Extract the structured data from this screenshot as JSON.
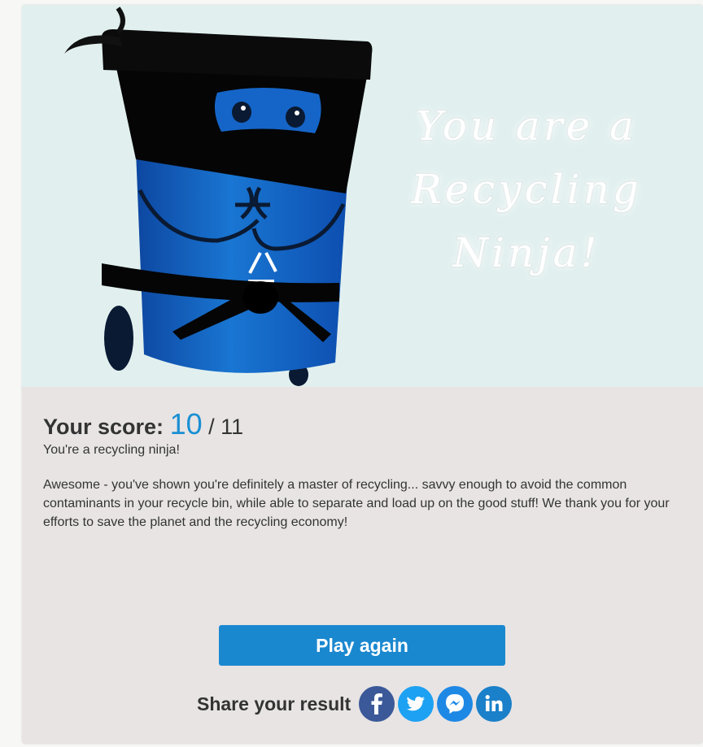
{
  "hero": {
    "headline_line1": "You are a",
    "headline_line2": "Recycling",
    "headline_line3": "Ninja!"
  },
  "result": {
    "score_label": "Your score:",
    "score": "10",
    "total": "/ 11",
    "subtitle": "You're a recycling ninja!",
    "description": "Awesome - you've shown you're definitely a master of recycling... savvy enough to avoid the common contaminants in your recycle bin, while able to separate and load up on the good stuff! We thank you for your efforts to save the planet and the recycling economy!"
  },
  "actions": {
    "play_again_label": "Play again",
    "share_label": "Share your result"
  },
  "share_icons": [
    "facebook-icon",
    "twitter-icon",
    "messenger-icon",
    "linkedin-icon"
  ],
  "colors": {
    "accent": "#1a88cf",
    "hero_bg": "#e1f0ef",
    "card_bg": "#e8e4e4",
    "bin_blue": "#1565c8"
  }
}
